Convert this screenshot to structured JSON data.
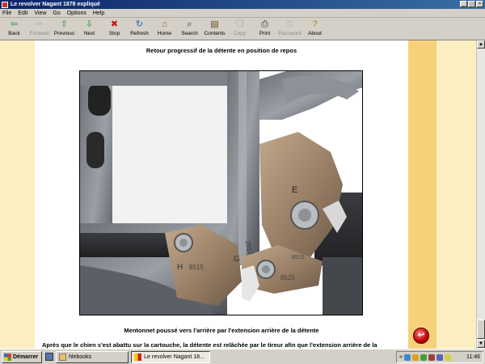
{
  "window": {
    "title": "Le revolver Nagant 1878 expliqué",
    "controls": [
      "_",
      "□",
      "×"
    ]
  },
  "menu": [
    "File",
    "Edit",
    "View",
    "Go",
    "Options",
    "Help"
  ],
  "toolbar": [
    {
      "label": "Back",
      "icon": "back-arrow-icon",
      "glyph": "⇦",
      "color": "#2a8a2a",
      "enabled": true
    },
    {
      "label": "Forward",
      "icon": "forward-arrow-icon",
      "glyph": "⇨",
      "color": "#888888",
      "enabled": false
    },
    {
      "label": "Previous",
      "icon": "up-arrow-icon",
      "glyph": "⇧",
      "color": "#1aa01a",
      "enabled": true
    },
    {
      "label": "Next",
      "icon": "down-arrow-icon",
      "glyph": "⇩",
      "color": "#1aa01a",
      "enabled": true
    },
    {
      "label": "Stop",
      "icon": "stop-icon",
      "glyph": "✖",
      "color": "#d01010",
      "enabled": true
    },
    {
      "label": "Refresh",
      "icon": "refresh-icon",
      "glyph": "↻",
      "color": "#2a5db0",
      "enabled": true
    },
    {
      "label": "Home",
      "icon": "home-icon",
      "glyph": "⌂",
      "color": "#a0522d",
      "enabled": true
    },
    {
      "label": "Search",
      "icon": "search-icon",
      "glyph": "⌕",
      "color": "#333333",
      "enabled": true
    },
    {
      "label": "Contents",
      "icon": "contents-icon",
      "glyph": "▤",
      "color": "#6a4a1a",
      "enabled": true
    },
    {
      "label": "Copy",
      "icon": "copy-icon",
      "glyph": "❐",
      "color": "#888888",
      "enabled": false
    },
    {
      "label": "Print",
      "icon": "print-icon",
      "glyph": "⎙",
      "color": "#333333",
      "enabled": true
    },
    {
      "label": "Password",
      "icon": "password-icon",
      "glyph": "⚿",
      "color": "#888888",
      "enabled": false
    },
    {
      "label": "About",
      "icon": "about-icon",
      "glyph": "?",
      "color": "#b08a00",
      "enabled": true
    }
  ],
  "page": {
    "title": "Retour progressif de la détente en position de repos",
    "caption": "Mentonnet poussé vers l'arrière par l'extension arrière de la détente",
    "paragraph": "Après que le chien s'est abattu sur la cartouche, la détente est relâchée par le tireur afin que l'extension arrière de la",
    "photo_markings": [
      "H",
      "8515",
      "G",
      "2557",
      "E",
      "8515",
      "8525"
    ]
  },
  "taskbar": {
    "start_label": "Démarrer",
    "tasks": [
      {
        "label": "hlebooks",
        "active": false
      },
      {
        "label": "Le revolver Nagant 18...",
        "active": true
      }
    ],
    "tray_chevron": "«",
    "clock": "11:46"
  },
  "colors": {
    "stripe_light": "#fbefc2",
    "stripe_dark": "#f7d07a",
    "title_bar": "#0a246a"
  }
}
